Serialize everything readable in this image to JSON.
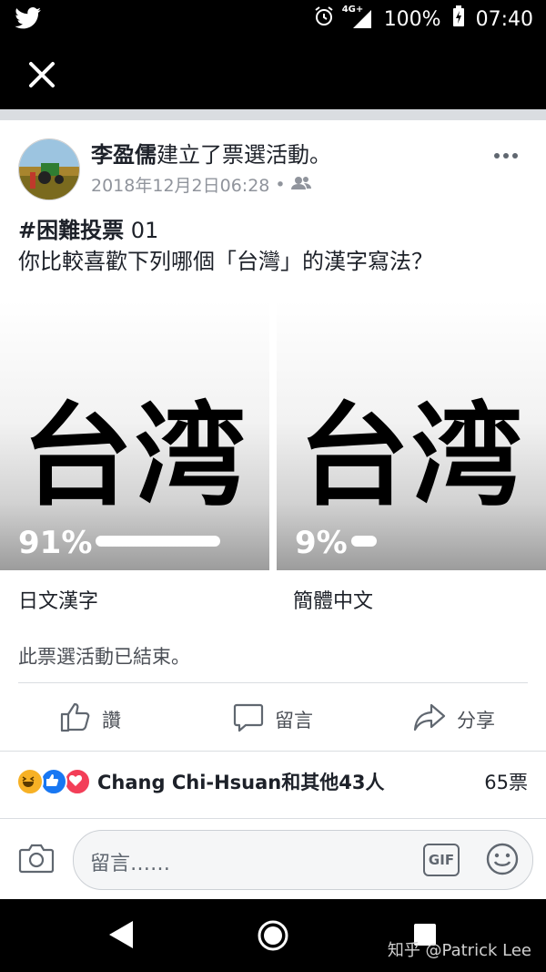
{
  "status": {
    "network": "4G+",
    "battery": "100%",
    "time": "07:40"
  },
  "post": {
    "author": "李盈儒",
    "action": "建立了票選活動。",
    "timestamp": "2018年12月2日06:28",
    "hashtag": "#困難投票",
    "hashtag_suffix": " 01",
    "question": "你比較喜歡下列哪個「台灣」的漢字寫法？"
  },
  "poll": {
    "options": [
      {
        "glyph": "台湾",
        "percent_label": "91%",
        "percent": 91,
        "label": "日文漢字"
      },
      {
        "glyph": "台湾",
        "percent_label": "9%",
        "percent": 9,
        "label": "簡體中文"
      }
    ],
    "ended_text": "此票選活動已結束。"
  },
  "actions": {
    "like": "讚",
    "comment": "留言",
    "share": "分享"
  },
  "reactions": {
    "text": "Chang Chi-Hsuan和其他43人",
    "votes": "65票"
  },
  "composer": {
    "placeholder": "留言……",
    "gif": "GIF"
  },
  "watermark": "知乎 @Patrick Lee",
  "colors": {
    "like_blue": "#1877f2",
    "love_red": "#f33e58",
    "haha_yellow": "#f7b125"
  }
}
